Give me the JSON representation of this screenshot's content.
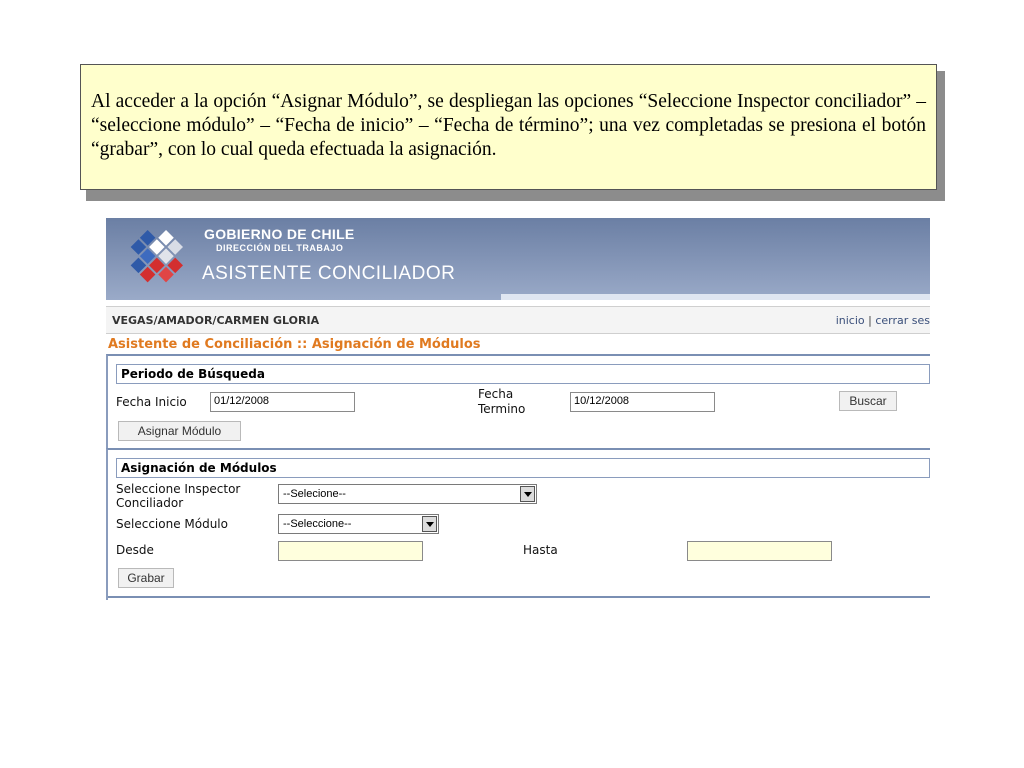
{
  "note": {
    "text": "Al acceder a la opción “Asignar Módulo”, se despliegan las opciones “Seleccione Inspector conciliador” – “seleccione módulo” – “Fecha de inicio” – “Fecha de término”; una vez completadas se presiona el botón “grabar”, con lo cual queda efectuada la asignación."
  },
  "header": {
    "org": "GOBIERNO DE CHILE",
    "division": "DIRECCIÓN DEL TRABAJO",
    "app_title": "ASISTENTE CONCILIADOR",
    "logo_icon": "gobierno-de-chile-logo"
  },
  "userbar": {
    "user": "VEGAS/AMADOR/CARMEN GLORIA",
    "inicio": "inicio",
    "separator": "|",
    "cerrar": "cerrar ses"
  },
  "breadcrumb": "Asistente de Conciliación :: Asignación de Módulos",
  "search": {
    "title": "Periodo de Búsqueda",
    "fecha_inicio_label": "Fecha Inicio",
    "fecha_inicio_value": "01/12/2008",
    "fecha_termino_label_1": "Fecha",
    "fecha_termino_label_2": "Termino",
    "fecha_termino_value": "10/12/2008",
    "buscar_label": "Buscar",
    "asignar_label": "Asignar Módulo"
  },
  "assign": {
    "title": "Asignación de Módulos",
    "inspector_label_1": "Seleccione Inspector",
    "inspector_label_2": "Conciliador",
    "inspector_value": "--Selecione--",
    "modulo_label": "Seleccione Módulo",
    "modulo_value": "--Seleccione--",
    "desde_label": "Desde",
    "desde_value": "",
    "hasta_label": "Hasta",
    "hasta_value": "",
    "grabar_label": "Grabar"
  },
  "colors": {
    "note_bg": "#ffffcc",
    "banner": "#7f91b3",
    "breadcrumb": "#e07a20",
    "panel_border": "#8a9cbd"
  }
}
